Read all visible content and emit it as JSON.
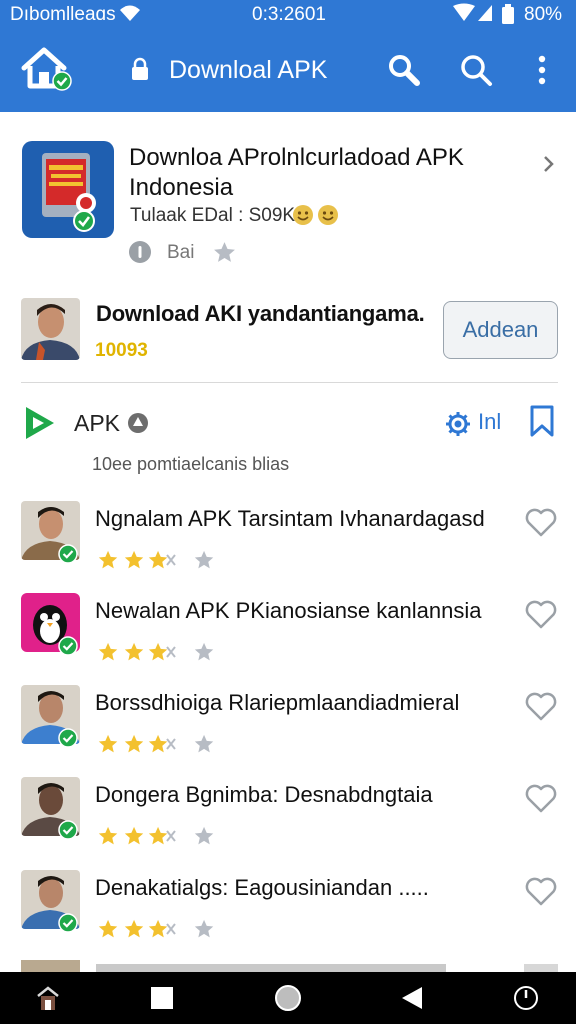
{
  "status_bar": {
    "carrier": "Dıbomlleaɑs",
    "time": "0:3:2601",
    "battery": "80%"
  },
  "app_bar": {
    "title": "Downloal APK",
    "icons": [
      "home-icon",
      "lock-icon",
      "search-icon",
      "search-icon",
      "more-vert-icon"
    ]
  },
  "featured": {
    "title_line1": "Downloa AProlnlcurladoad APK",
    "title_line2": "Indonesia",
    "meta": "Tulaak EDal : S09K",
    "sub_label": "Bai"
  },
  "promo": {
    "title": "Download AKI yandantiangama.",
    "count": "10093",
    "button_label": "Addean"
  },
  "section": {
    "title": "APK",
    "link_label": "Inl",
    "subtitle": "10ee pomtiaelcanis blias"
  },
  "items": [
    {
      "name": "Ngnalam APK Tarsintam Ivhanardagasd",
      "rating": 3,
      "avatar": "man-glasses",
      "accent": "#8a6b4a"
    },
    {
      "name": "Newalan APK PKianosianse kanlannsia",
      "rating": 3,
      "avatar": "penguin-app",
      "accent": "#e0218a"
    },
    {
      "name": "Borssdhioiga Rlariepmlaandiadmieral",
      "rating": 3,
      "avatar": "man-blue",
      "accent": "#3d7fcf"
    },
    {
      "name": "Dongera Bgnimba: Desnabdngtaia",
      "rating": 3,
      "avatar": "man-dark",
      "accent": "#5a4a44"
    },
    {
      "name": "Denakatialgs: Eagousiniandan .....",
      "rating": 3,
      "avatar": "man-smile",
      "accent": "#3a6fb0"
    }
  ],
  "colors": {
    "primary": "#2f78d4",
    "star": "#f3c12e",
    "star_empty": "#b7bcc4",
    "verified": "#1fa84a",
    "promo_count": "#e0b400"
  }
}
